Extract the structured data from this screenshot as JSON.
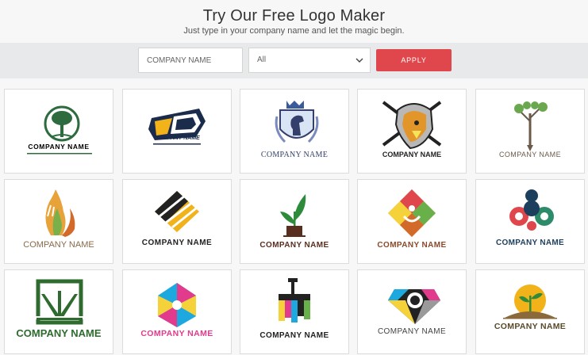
{
  "header": {
    "title": "Try Our Free Logo Maker",
    "subtitle": "Just type in your company name and let the magic begin."
  },
  "filter": {
    "name_placeholder": "COMPANY NAME",
    "category_value": "All",
    "apply_label": "APPLY"
  },
  "logos": [
    {
      "name": "COMPANY NAME",
      "icon": "tree-emblem-icon",
      "color": "#2e6b3f"
    },
    {
      "name": "COMPANY NAME",
      "icon": "car-badge-icon",
      "color": "#1a2b4c"
    },
    {
      "name": "COMPANY NAME",
      "icon": "chess-knight-shield-icon",
      "color": "#34406b"
    },
    {
      "name": "COMPANY NAME",
      "icon": "eagle-hockey-icon",
      "color": "#222222"
    },
    {
      "name": "COMPANY NAME",
      "icon": "tree-pen-icon",
      "color": "#6b5a4a"
    },
    {
      "name": "COMPANY NAME",
      "icon": "hands-flame-icon",
      "color": "#8a6a4a"
    },
    {
      "name": "COMPANY NAME",
      "icon": "diamond-stripes-icon",
      "color": "#222222"
    },
    {
      "name": "COMPANY NAME",
      "icon": "plant-pot-icon",
      "color": "#5a2e1f"
    },
    {
      "name": "COMPANY NAME",
      "icon": "colorful-diamond-person-icon",
      "color": "#8a4a2a"
    },
    {
      "name": "COMPANY NAME",
      "icon": "circles-triad-icon",
      "color": "#1d3f5e"
    },
    {
      "name": "COMPANY NAME",
      "icon": "green-frame-icon",
      "color": "#2f6b2f"
    },
    {
      "name": "COMPANY NAME",
      "icon": "colorful-pinwheel-icon",
      "color": "#e23a8c"
    },
    {
      "name": "COMPANY NAME",
      "icon": "paint-roller-icon",
      "color": "#222222"
    },
    {
      "name": "COMPANY NAME",
      "icon": "camera-diamond-icon",
      "color": "#444444"
    },
    {
      "name": "COMPANY NAME",
      "icon": "sun-sprout-icon",
      "color": "#5a4a2a"
    }
  ],
  "colors": {
    "apply_button": "#e0474c",
    "filter_bar": "#e8e9ea",
    "header_bg": "#f7f7f7"
  }
}
